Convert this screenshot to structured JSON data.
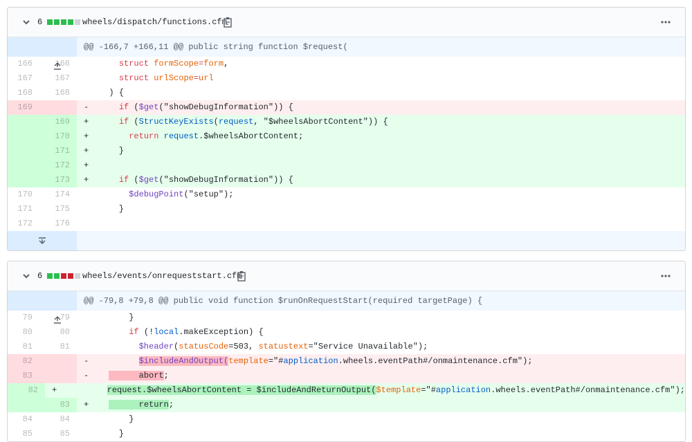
{
  "files": [
    {
      "count": "6",
      "path": "wheels/dispatch/functions.cfm",
      "hunk": "@@ -166,7 +166,11 @@ public string function $request(",
      "blocks": [
        "#2cbe4e",
        "#2cbe4e",
        "#2cbe4e",
        "#2cbe4e",
        "#d1d5da"
      ],
      "lines": [
        {
          "type": "ctx",
          "old": "166",
          "new": "166",
          "segs": [
            [
              "    ",
              ""
            ],
            [
              "struct ",
              "kw"
            ],
            [
              "formScope",
              "var"
            ],
            [
              "=",
              "kw"
            ],
            [
              "form",
              "var"
            ],
            [
              ",",
              ""
            ]
          ]
        },
        {
          "type": "ctx",
          "old": "167",
          "new": "167",
          "segs": [
            [
              "    ",
              ""
            ],
            [
              "struct ",
              "kw"
            ],
            [
              "urlScope",
              "var"
            ],
            [
              "=",
              "kw"
            ],
            [
              "url",
              "var"
            ]
          ]
        },
        {
          "type": "ctx",
          "old": "168",
          "new": "168",
          "segs": [
            [
              "  ) {",
              ""
            ]
          ]
        },
        {
          "type": "del",
          "old": "169",
          "new": "",
          "sign": "-",
          "segs": [
            [
              "    ",
              ""
            ],
            [
              "if ",
              "kw"
            ],
            [
              "(",
              ""
            ],
            [
              "$get",
              "fn"
            ],
            [
              "(\"showDebugInformation\")) {",
              ""
            ]
          ]
        },
        {
          "type": "add",
          "old": "",
          "new": "169",
          "sign": "+",
          "segs": [
            [
              "    ",
              ""
            ],
            [
              "if ",
              "kw"
            ],
            [
              "(",
              ""
            ],
            [
              "StructKeyExists",
              "con"
            ],
            [
              "(",
              ""
            ],
            [
              "request",
              "con"
            ],
            [
              ", \"$wheelsAbortContent\")) {",
              ""
            ]
          ]
        },
        {
          "type": "add",
          "old": "",
          "new": "170",
          "sign": "+",
          "segs": [
            [
              "      ",
              ""
            ],
            [
              "return ",
              "kw"
            ],
            [
              "request",
              "con"
            ],
            [
              ".$wheelsAbortContent;",
              ""
            ]
          ]
        },
        {
          "type": "add",
          "old": "",
          "new": "171",
          "sign": "+",
          "segs": [
            [
              "    }",
              ""
            ]
          ]
        },
        {
          "type": "add",
          "old": "",
          "new": "172",
          "sign": "+",
          "segs": [
            [
              "",
              ""
            ]
          ]
        },
        {
          "type": "add",
          "old": "",
          "new": "173",
          "sign": "+",
          "segs": [
            [
              "    ",
              ""
            ],
            [
              "if ",
              "kw"
            ],
            [
              "(",
              ""
            ],
            [
              "$get",
              "fn"
            ],
            [
              "(\"showDebugInformation\")) {",
              ""
            ]
          ]
        },
        {
          "type": "ctx",
          "old": "170",
          "new": "174",
          "segs": [
            [
              "      ",
              ""
            ],
            [
              "$debugPoint",
              "fn"
            ],
            [
              "(\"setup\");",
              ""
            ]
          ]
        },
        {
          "type": "ctx",
          "old": "171",
          "new": "175",
          "segs": [
            [
              "    }",
              ""
            ]
          ]
        },
        {
          "type": "ctx",
          "old": "172",
          "new": "176",
          "segs": [
            [
              "",
              ""
            ]
          ]
        }
      ]
    },
    {
      "count": "6",
      "path": "wheels/events/onrequeststart.cfm",
      "hunk": "@@ -79,8 +79,8 @@ public void function $runOnRequestStart(required targetPage) {",
      "blocks": [
        "#2cbe4e",
        "#2cbe4e",
        "#cb2431",
        "#cb2431",
        "#d1d5da"
      ],
      "lines": [
        {
          "type": "ctx",
          "old": "79",
          "new": "79",
          "segs": [
            [
              "      }",
              ""
            ]
          ]
        },
        {
          "type": "ctx",
          "old": "80",
          "new": "80",
          "segs": [
            [
              "      ",
              ""
            ],
            [
              "if ",
              "kw"
            ],
            [
              "(!",
              ""
            ],
            [
              "local",
              "con"
            ],
            [
              ".makeException) {",
              ""
            ]
          ]
        },
        {
          "type": "ctx",
          "old": "81",
          "new": "81",
          "segs": [
            [
              "        ",
              ""
            ],
            [
              "$header",
              "fn"
            ],
            [
              "(",
              ""
            ],
            [
              "statusCode",
              "var"
            ],
            [
              "=",
              ""
            ],
            [
              "503",
              ""
            ],
            [
              ", ",
              ""
            ],
            [
              "statustext",
              "var"
            ],
            [
              "=\"Service Unavailable\");",
              ""
            ]
          ]
        },
        {
          "type": "del",
          "old": "82",
          "new": "",
          "sign": "-",
          "segs": [
            [
              "        ",
              ""
            ],
            [
              "$includeAndOutput(",
              "fn hl-del"
            ],
            [
              "template",
              "var"
            ],
            [
              "=\"#",
              ""
            ],
            [
              "application",
              "con"
            ],
            [
              ".wheels.eventPath#/onmaintenance.cfm\");",
              ""
            ]
          ]
        },
        {
          "type": "del",
          "old": "83",
          "new": "",
          "sign": "-",
          "segs": [
            [
              "  ",
              ""
            ],
            [
              "      abort",
              "hl-del"
            ],
            [
              ";",
              ""
            ]
          ]
        },
        {
          "type": "add",
          "old": "",
          "new": "82",
          "sign": "+",
          "segs": [
            [
              "        ",
              ""
            ],
            [
              "request.$wheelsAbortContent = $includeAndReturnOutput(",
              "hl-add"
            ],
            [
              "$template",
              "var"
            ],
            [
              "=\"#",
              ""
            ],
            [
              "application",
              "con"
            ],
            [
              ".wheels.eventPath#/onmaintenance.cfm\");",
              ""
            ]
          ]
        },
        {
          "type": "add",
          "old": "",
          "new": "83",
          "sign": "+",
          "segs": [
            [
              "  ",
              ""
            ],
            [
              "      return",
              "hl-add"
            ],
            [
              ";",
              ""
            ]
          ]
        },
        {
          "type": "ctx",
          "old": "84",
          "new": "84",
          "segs": [
            [
              "      }",
              ""
            ]
          ]
        },
        {
          "type": "ctx",
          "old": "85",
          "new": "85",
          "segs": [
            [
              "    }",
              ""
            ]
          ]
        }
      ]
    }
  ]
}
